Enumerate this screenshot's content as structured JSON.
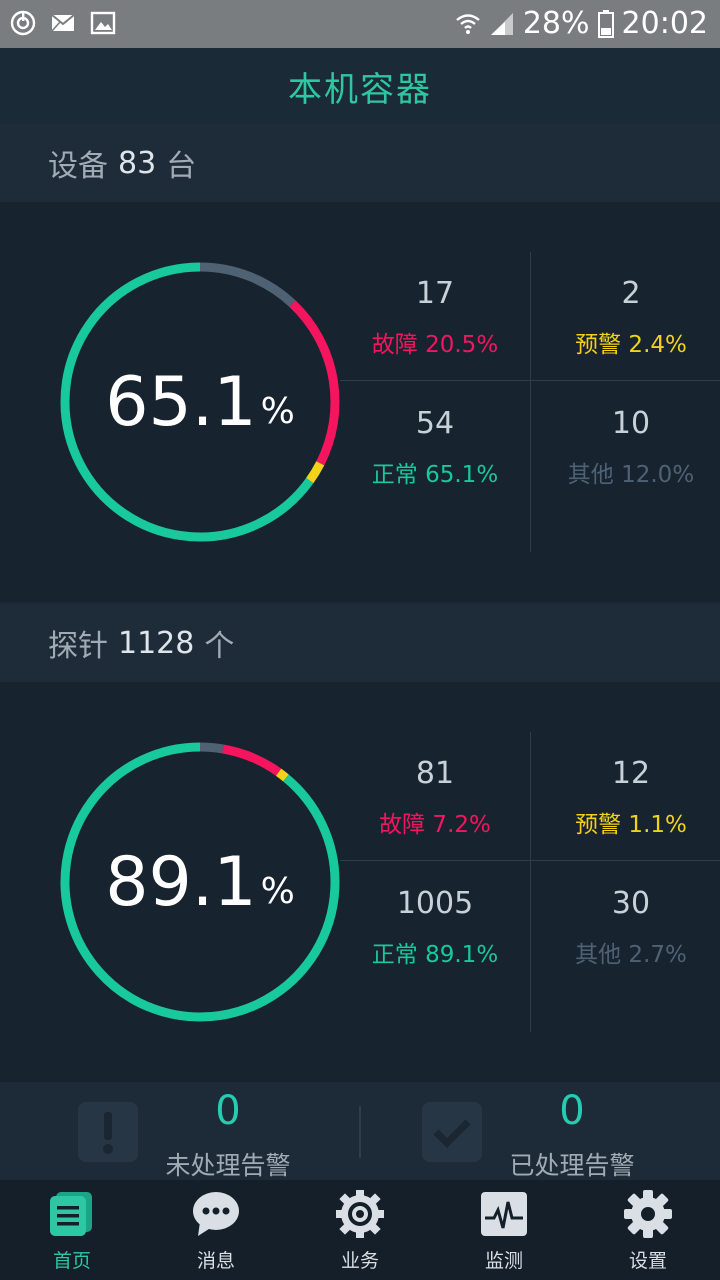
{
  "status_bar": {
    "battery": "28%",
    "time": "20:02",
    "icons": [
      "sync-icon",
      "mail-icon",
      "image-icon",
      "wifi-icon",
      "signal-icon",
      "battery-icon"
    ]
  },
  "header": {
    "title": "本机容器"
  },
  "devices": {
    "label": "设备",
    "count": "83",
    "unit": "台",
    "ring": {
      "percent": "65.1",
      "percent_sign": "%",
      "fault": 0.205,
      "warn": 0.024,
      "normal": 0.651,
      "other": 0.12
    },
    "stats": [
      {
        "count": "17",
        "label": "故障 20.5%",
        "color": "#f5155f"
      },
      {
        "count": "2",
        "label": "预警 2.4%",
        "color": "#f2d21a"
      },
      {
        "count": "54",
        "label": "正常 65.1%",
        "color": "#18c99c"
      },
      {
        "count": "10",
        "label": "其他 12.0%",
        "color": "#4f6273"
      }
    ]
  },
  "probes": {
    "label": "探针",
    "count": "1128",
    "unit": "个",
    "ring": {
      "percent": "89.1",
      "percent_sign": "%",
      "fault": 0.072,
      "warn": 0.011,
      "normal": 0.891,
      "other": 0.027
    },
    "stats": [
      {
        "count": "81",
        "label": "故障 7.2%",
        "color": "#f5155f"
      },
      {
        "count": "12",
        "label": "预警 1.1%",
        "color": "#f2d21a"
      },
      {
        "count": "1005",
        "label": "正常 89.1%",
        "color": "#18c99c"
      },
      {
        "count": "30",
        "label": "其他 2.7%",
        "color": "#4f6273"
      }
    ]
  },
  "alerts": {
    "unhandled": {
      "count": "0",
      "label": "未处理告警",
      "icon": "exclamation-icon"
    },
    "handled": {
      "count": "0",
      "label": "已处理告警",
      "icon": "checkmark-icon"
    }
  },
  "nav": [
    {
      "label": "首页",
      "icon": "home-list-icon",
      "active": true
    },
    {
      "label": "消息",
      "icon": "message-icon",
      "active": false
    },
    {
      "label": "业务",
      "icon": "business-gear-icon",
      "active": false
    },
    {
      "label": "监测",
      "icon": "monitor-pulse-icon",
      "active": false
    },
    {
      "label": "设置",
      "icon": "settings-gear-icon",
      "active": false
    }
  ],
  "colors": {
    "accent": "#2ec7a3",
    "fault": "#f5155f",
    "warn": "#f2d21a",
    "normal": "#18c99c",
    "other": "#4f6273"
  }
}
